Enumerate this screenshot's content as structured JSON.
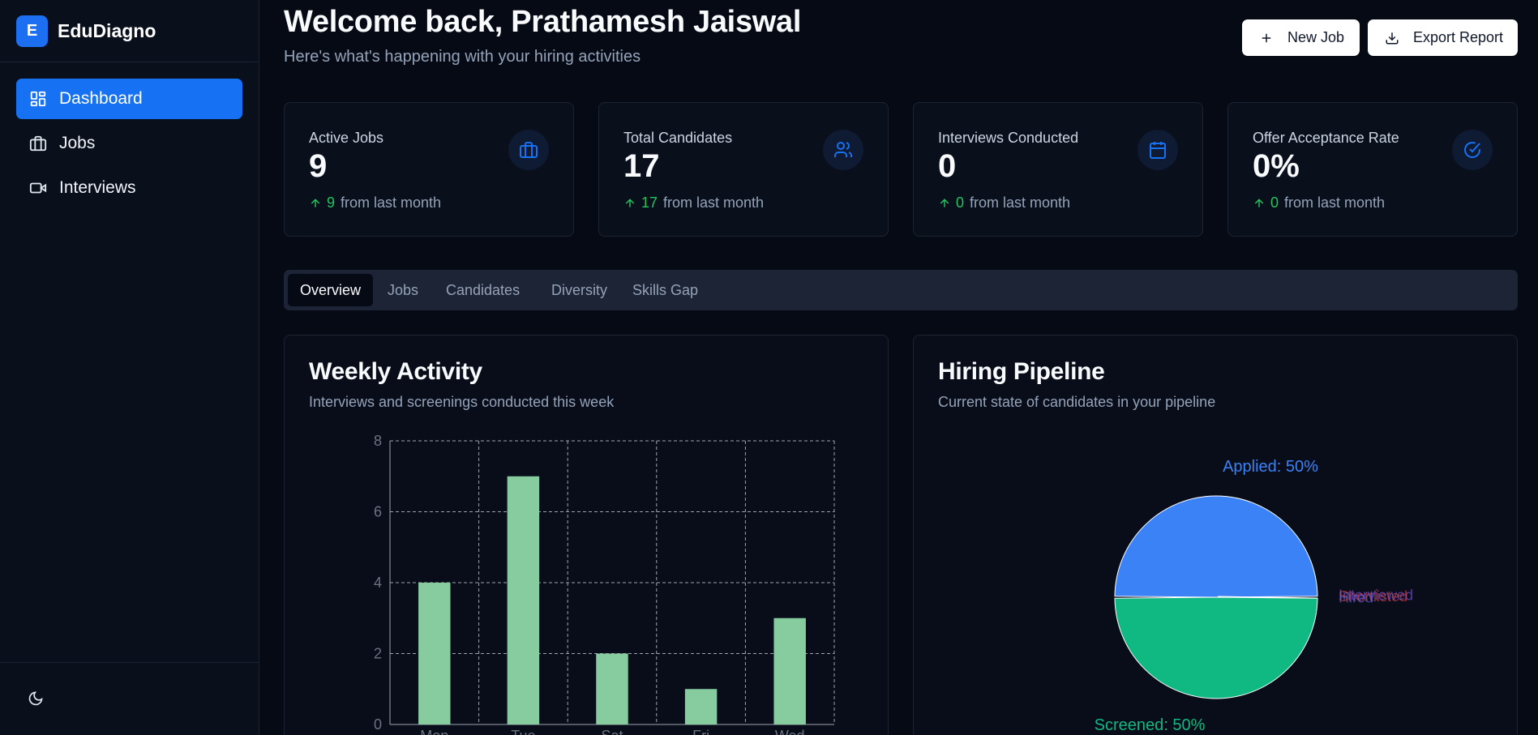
{
  "app": {
    "logo_letter": "E",
    "name": "EduDiagno"
  },
  "sidebar": {
    "items": [
      {
        "label": "Dashboard",
        "icon": "dashboard-icon",
        "active": true
      },
      {
        "label": "Jobs",
        "icon": "briefcase-icon",
        "active": false
      },
      {
        "label": "Interviews",
        "icon": "video-icon",
        "active": false
      }
    ],
    "footer_icon": "moon-icon"
  },
  "header": {
    "title": "Welcome back, Prathamesh Jaiswal",
    "subtitle": "Here's what's happening with your hiring activities",
    "new_job_label": "New Job",
    "export_label": "Export Report"
  },
  "stats": [
    {
      "label": "Active Jobs",
      "value": "9",
      "change": "9",
      "change_text": "from last month",
      "icon": "briefcase-icon"
    },
    {
      "label": "Total Candidates",
      "value": "17",
      "change": "17",
      "change_text": "from last month",
      "icon": "users-icon"
    },
    {
      "label": "Interviews Conducted",
      "value": "0",
      "change": "0",
      "change_text": "from last month",
      "icon": "calendar-icon"
    },
    {
      "label": "Offer Acceptance Rate",
      "value": "0%",
      "change": "0",
      "change_text": "from last month",
      "icon": "check-circle-icon"
    }
  ],
  "tabs": [
    "Overview",
    "Jobs",
    "Candidates",
    "Diversity",
    "Skills Gap"
  ],
  "weekly_card": {
    "title": "Weekly Activity",
    "subtitle": "Interviews and screenings conducted this week"
  },
  "pipeline_card": {
    "title": "Hiring Pipeline",
    "subtitle": "Current state of candidates in your pipeline"
  },
  "colors": {
    "accent": "#1671f3",
    "bar": "#86cc9f",
    "applied": "#3b82f6",
    "screened": "#10b981",
    "positive": "#22c55e"
  },
  "chart_data": [
    {
      "type": "bar",
      "categories": [
        "Mon",
        "Tue",
        "Sat",
        "Fri",
        "Wed"
      ],
      "values": [
        4,
        7,
        2,
        1,
        3
      ],
      "ylim": [
        0,
        8
      ],
      "yticks": [
        0,
        2,
        4,
        6,
        8
      ],
      "grid": true
    },
    {
      "type": "pie",
      "slices": [
        {
          "label": "Applied",
          "value": 50,
          "display": "Applied: 50%",
          "color": "#3b82f6"
        },
        {
          "label": "Screened",
          "value": 50,
          "display": "Screened: 50%",
          "color": "#10b981"
        },
        {
          "label": "Interviewed",
          "value": 0,
          "display": "Interviewed",
          "color": "#8b5cf6"
        },
        {
          "label": "Shortlisted",
          "value": 0,
          "display": "Shortlisted",
          "color": "#ef4444"
        },
        {
          "label": "Hired",
          "value": 0,
          "display": "Hired",
          "color": "#6366f1"
        }
      ]
    }
  ]
}
